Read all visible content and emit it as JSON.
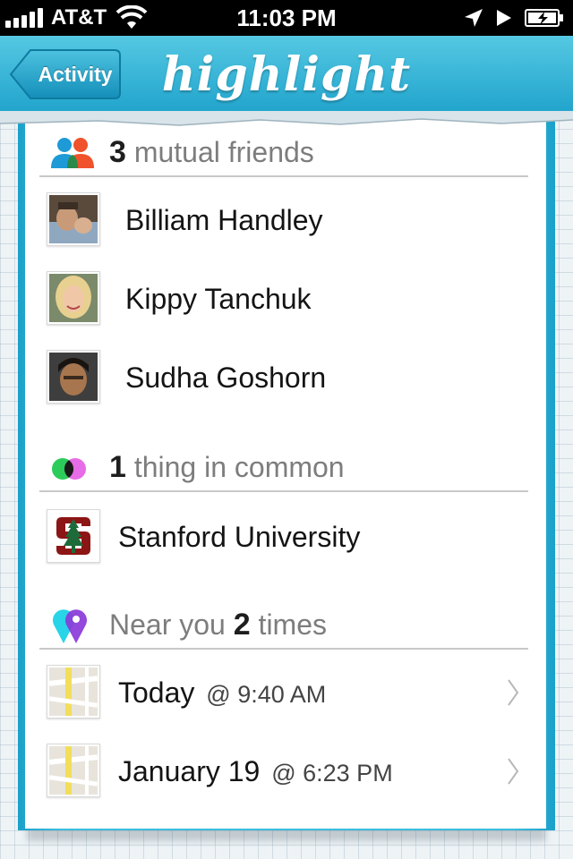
{
  "status_bar": {
    "carrier": "AT&T",
    "time": "11:03 PM"
  },
  "nav": {
    "back_label": "Activity",
    "logo_text": "highlight"
  },
  "mutual": {
    "count": "3",
    "label": " mutual friends",
    "icon": "people-icon",
    "friends": [
      {
        "name": "Billiam Handley"
      },
      {
        "name": "Kippy Tanchuk"
      },
      {
        "name": "Sudha Goshorn"
      }
    ]
  },
  "common": {
    "count": "1",
    "label": " thing in common",
    "icon": "overlap-circles-icon",
    "items": [
      {
        "name": "Stanford University"
      }
    ]
  },
  "near": {
    "prefix": "Near you ",
    "count": "2",
    "suffix": " times",
    "icon": "map-pins-icon",
    "visits": [
      {
        "date": "Today",
        "time": "@ 9:40 AM"
      },
      {
        "date": "January 19",
        "time": "@ 6:23 PM"
      }
    ]
  },
  "colors": {
    "nav_blue": "#1fa3cc",
    "stanford_red": "#8c1515"
  }
}
